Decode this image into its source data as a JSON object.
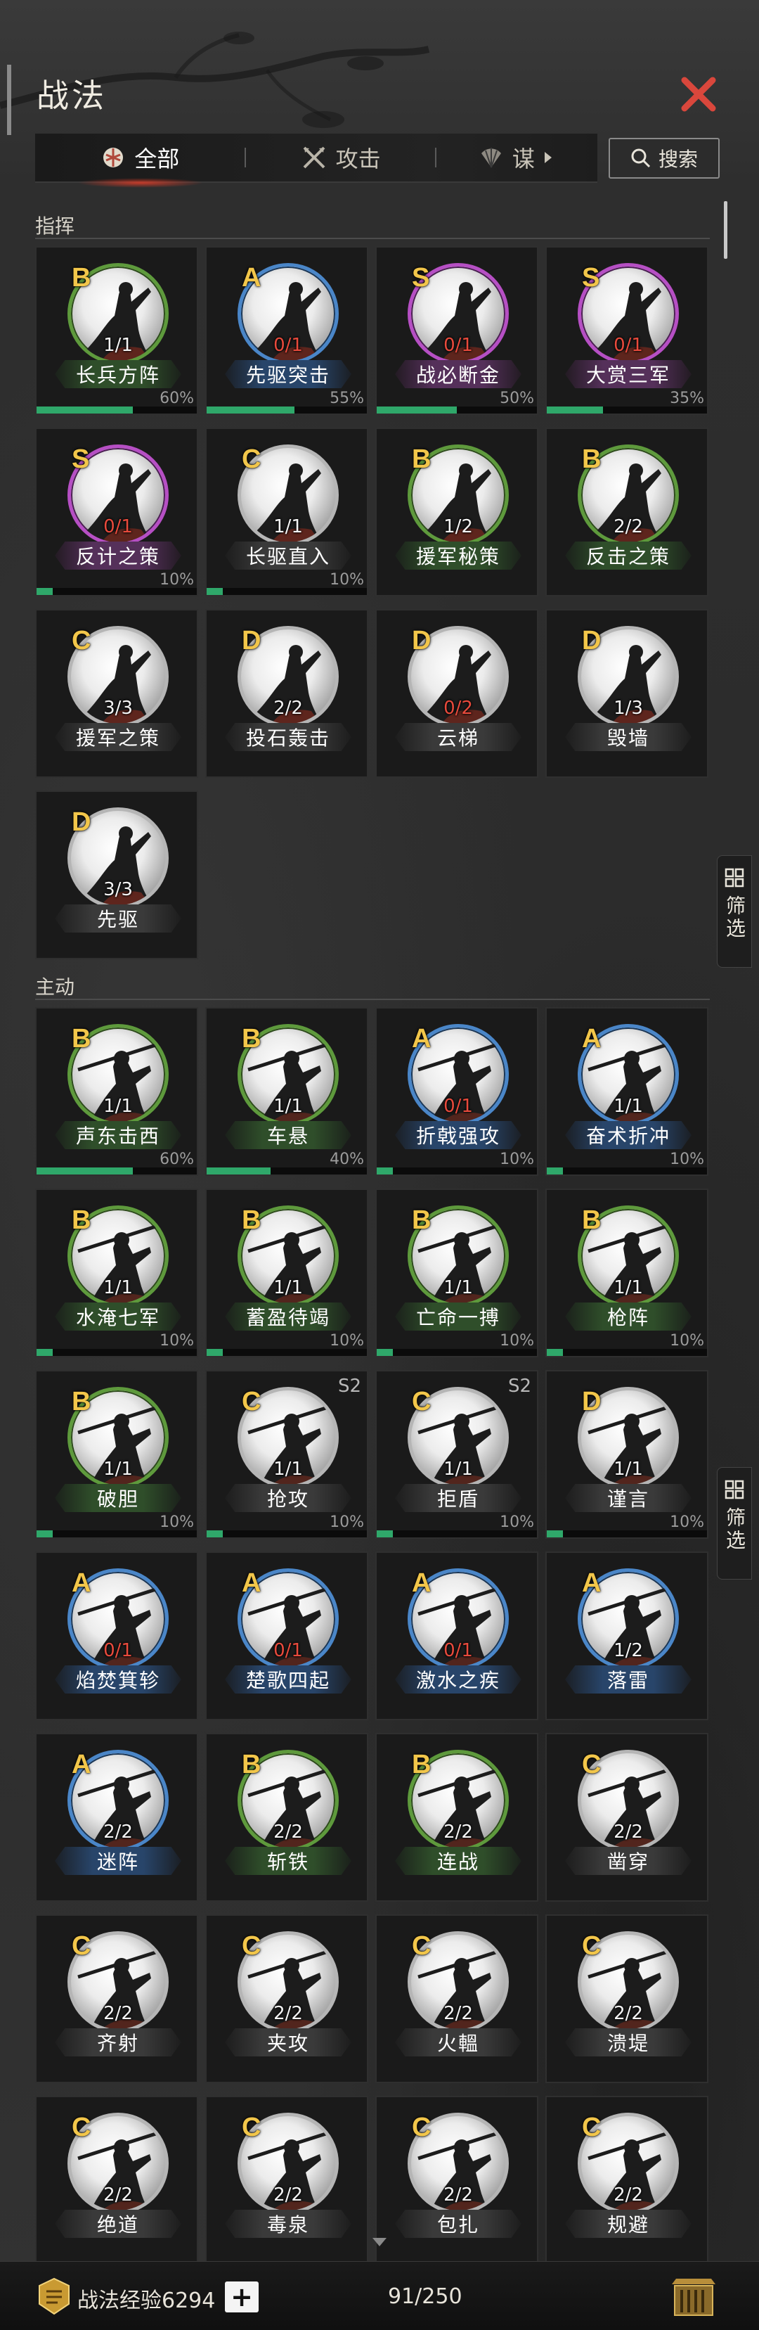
{
  "header": {
    "title": "战法"
  },
  "tabs": [
    {
      "label": "全部",
      "icon": "all-icon"
    },
    {
      "label": "攻击",
      "icon": "crossed-swords-icon"
    },
    {
      "label": "谋",
      "icon": "fan-icon"
    }
  ],
  "search": {
    "label": "搜索"
  },
  "sections": [
    {
      "label": "指挥"
    },
    {
      "label": "主动"
    }
  ],
  "filter": {
    "label": "筛选"
  },
  "command_cards": [
    {
      "grade": "B",
      "name": "长兵方阵",
      "count": "1/1",
      "count_red": false,
      "percent": "60%",
      "progress": 0.6,
      "season": ""
    },
    {
      "grade": "A",
      "name": "先驱突击",
      "count": "0/1",
      "count_red": true,
      "percent": "55%",
      "progress": 0.55,
      "season": ""
    },
    {
      "grade": "S",
      "name": "战必断金",
      "count": "0/1",
      "count_red": true,
      "percent": "50%",
      "progress": 0.5,
      "season": ""
    },
    {
      "grade": "S",
      "name": "大赏三军",
      "count": "0/1",
      "count_red": true,
      "percent": "35%",
      "progress": 0.35,
      "season": ""
    },
    {
      "grade": "S",
      "name": "反计之策",
      "count": "0/1",
      "count_red": true,
      "percent": "10%",
      "progress": 0.1,
      "season": ""
    },
    {
      "grade": "C",
      "name": "长驱直入",
      "count": "1/1",
      "count_red": false,
      "percent": "10%",
      "progress": 0.1,
      "season": ""
    },
    {
      "grade": "B",
      "name": "援军秘策",
      "count": "1/2",
      "count_red": false,
      "percent": "",
      "progress": null,
      "season": ""
    },
    {
      "grade": "B",
      "name": "反击之策",
      "count": "2/2",
      "count_red": false,
      "percent": "",
      "progress": null,
      "season": ""
    },
    {
      "grade": "C",
      "name": "援军之策",
      "count": "3/3",
      "count_red": false,
      "percent": "",
      "progress": null,
      "season": ""
    },
    {
      "grade": "D",
      "name": "投石轰击",
      "count": "2/2",
      "count_red": false,
      "percent": "",
      "progress": null,
      "season": ""
    },
    {
      "grade": "D",
      "name": "云梯",
      "count": "0/2",
      "count_red": true,
      "percent": "",
      "progress": null,
      "season": ""
    },
    {
      "grade": "D",
      "name": "毁墙",
      "count": "1/3",
      "count_red": false,
      "percent": "",
      "progress": null,
      "season": ""
    },
    {
      "grade": "D",
      "name": "先驱",
      "count": "3/3",
      "count_red": false,
      "percent": "",
      "progress": null,
      "season": ""
    }
  ],
  "active_cards": [
    {
      "grade": "B",
      "name": "声东击西",
      "count": "1/1",
      "count_red": false,
      "percent": "60%",
      "progress": 0.6,
      "season": ""
    },
    {
      "grade": "B",
      "name": "车悬",
      "count": "1/1",
      "count_red": false,
      "percent": "40%",
      "progress": 0.4,
      "season": ""
    },
    {
      "grade": "A",
      "name": "折戟强攻",
      "count": "0/1",
      "count_red": true,
      "percent": "10%",
      "progress": 0.1,
      "season": ""
    },
    {
      "grade": "A",
      "name": "奋术折冲",
      "count": "1/1",
      "count_red": false,
      "percent": "10%",
      "progress": 0.1,
      "season": ""
    },
    {
      "grade": "B",
      "name": "水淹七军",
      "count": "1/1",
      "count_red": false,
      "percent": "10%",
      "progress": 0.1,
      "season": ""
    },
    {
      "grade": "B",
      "name": "蓄盈待竭",
      "count": "1/1",
      "count_red": false,
      "percent": "10%",
      "progress": 0.1,
      "season": ""
    },
    {
      "grade": "B",
      "name": "亡命一搏",
      "count": "1/1",
      "count_red": false,
      "percent": "10%",
      "progress": 0.1,
      "season": ""
    },
    {
      "grade": "B",
      "name": "枪阵",
      "count": "1/1",
      "count_red": false,
      "percent": "10%",
      "progress": 0.1,
      "season": ""
    },
    {
      "grade": "B",
      "name": "破胆",
      "count": "1/1",
      "count_red": false,
      "percent": "10%",
      "progress": 0.1,
      "season": ""
    },
    {
      "grade": "C",
      "name": "抢攻",
      "count": "1/1",
      "count_red": false,
      "percent": "10%",
      "progress": 0.1,
      "season": "S2"
    },
    {
      "grade": "C",
      "name": "拒盾",
      "count": "1/1",
      "count_red": false,
      "percent": "10%",
      "progress": 0.1,
      "season": "S2"
    },
    {
      "grade": "D",
      "name": "谨言",
      "count": "1/1",
      "count_red": false,
      "percent": "10%",
      "progress": 0.1,
      "season": ""
    },
    {
      "grade": "A",
      "name": "焰焚箕轸",
      "count": "0/1",
      "count_red": true,
      "percent": "",
      "progress": null,
      "season": ""
    },
    {
      "grade": "A",
      "name": "楚歌四起",
      "count": "0/1",
      "count_red": true,
      "percent": "",
      "progress": null,
      "season": ""
    },
    {
      "grade": "A",
      "name": "激水之疾",
      "count": "0/1",
      "count_red": true,
      "percent": "",
      "progress": null,
      "season": ""
    },
    {
      "grade": "A",
      "name": "落雷",
      "count": "1/2",
      "count_red": false,
      "percent": "",
      "progress": null,
      "season": ""
    },
    {
      "grade": "A",
      "name": "迷阵",
      "count": "2/2",
      "count_red": false,
      "percent": "",
      "progress": null,
      "season": ""
    },
    {
      "grade": "B",
      "name": "斩铁",
      "count": "2/2",
      "count_red": false,
      "percent": "",
      "progress": null,
      "season": ""
    },
    {
      "grade": "B",
      "name": "连战",
      "count": "2/2",
      "count_red": false,
      "percent": "",
      "progress": null,
      "season": ""
    },
    {
      "grade": "C",
      "name": "凿穿",
      "count": "2/2",
      "count_red": false,
      "percent": "",
      "progress": null,
      "season": ""
    },
    {
      "grade": "C",
      "name": "齐射",
      "count": "2/2",
      "count_red": false,
      "percent": "",
      "progress": null,
      "season": ""
    },
    {
      "grade": "C",
      "name": "夹攻",
      "count": "2/2",
      "count_red": false,
      "percent": "",
      "progress": null,
      "season": ""
    },
    {
      "grade": "C",
      "name": "火轀",
      "count": "2/2",
      "count_red": false,
      "percent": "",
      "progress": null,
      "season": ""
    },
    {
      "grade": "C",
      "name": "溃堤",
      "count": "2/2",
      "count_red": false,
      "percent": "",
      "progress": null,
      "season": ""
    },
    {
      "grade": "C",
      "name": "绝道",
      "count": "2/2",
      "count_red": false,
      "percent": "",
      "progress": null,
      "season": ""
    },
    {
      "grade": "C",
      "name": "毒泉",
      "count": "2/2",
      "count_red": false,
      "percent": "",
      "progress": null,
      "season": ""
    },
    {
      "grade": "C",
      "name": "包扎",
      "count": "2/2",
      "count_red": false,
      "percent": "",
      "progress": null,
      "season": ""
    },
    {
      "grade": "C",
      "name": "规避",
      "count": "2/2",
      "count_red": false,
      "percent": "",
      "progress": null,
      "season": ""
    }
  ],
  "footer": {
    "exp_label": "战法经验6294",
    "plus": "+",
    "capacity": "91/250"
  },
  "colors": {
    "grade": "#f2c64a",
    "ring_S": "#b64fc4",
    "ring_A": "#4a86c8",
    "ring_B": "#5e9a3c",
    "progress": "#2fa86a",
    "count_red": "#e84a3c",
    "close": "#d9473c"
  }
}
